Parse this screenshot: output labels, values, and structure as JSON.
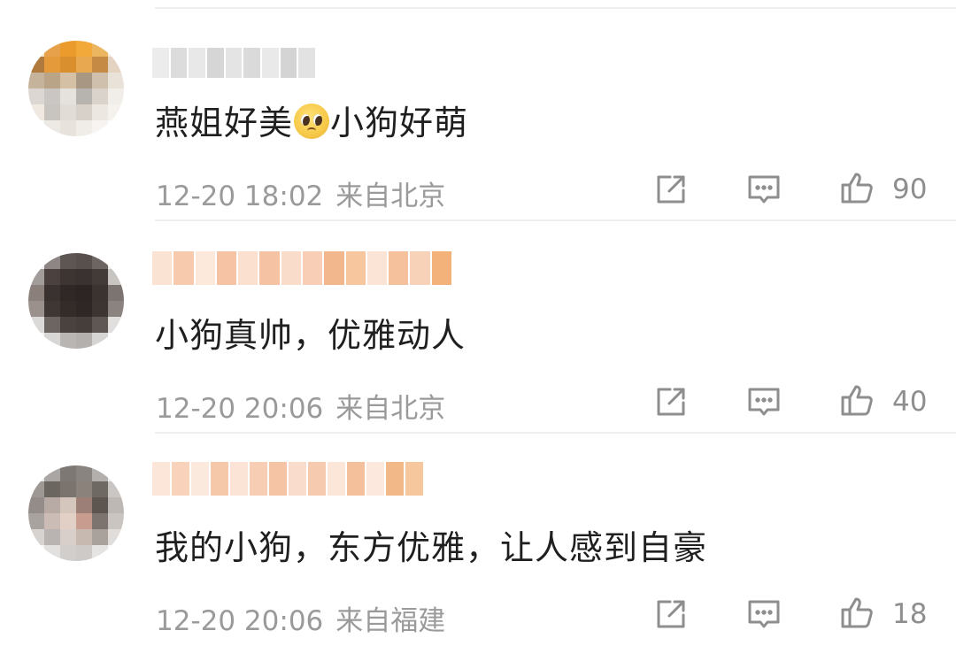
{
  "comments": [
    {
      "text_before": "燕姐好美",
      "emoji": "pleading-face-emoji",
      "text_after": "小狗好萌",
      "time": "12-20 18:02",
      "location": "来自北京",
      "likes": "90",
      "username_blur_colors": [
        "#ececec",
        "#dcdcdc",
        "#e8e8e8",
        "#d6d6d6",
        "#e4e4e4",
        "#dadada",
        "#e9e9e9",
        "#d4d4d4",
        "#e2e2e2"
      ],
      "avatar_colors": [
        "#f4e3c9",
        "#e7a14a",
        "#eb9b2c",
        "#f3a83a",
        "#ecb661",
        "#f6ead6",
        "#b07a3e",
        "#e49a3a",
        "#d98f2d",
        "#e7a84f",
        "#c58a44",
        "#e3d3c0",
        "#c6b39c",
        "#b9a487",
        "#d4c1a5",
        "#a89883",
        "#cfc0ad",
        "#e9e2d9",
        "#dcd7d2",
        "#c9c6c3",
        "#e5e1dc",
        "#b7b3ae",
        "#d9d3cc",
        "#f1ede8",
        "#efe9e2",
        "#c8c4bf",
        "#e2dcd6",
        "#d7d1ca",
        "#ece7e1",
        "#f5f2ee",
        "#fbfaf8",
        "#ede9e4",
        "#e7e2dc",
        "#f0ece7",
        "#f7f4f1",
        "#fdfcfb"
      ]
    },
    {
      "text": "小狗真帅，优雅动人",
      "time": "12-20 20:06",
      "location": "来自北京",
      "likes": "40",
      "username_blur_colors": [
        "#fbe3d3",
        "#f7c9ad",
        "#fde9dc",
        "#f6c4a5",
        "#fbe0cf",
        "#f5c2a3",
        "#fadccb",
        "#f8cfb6",
        "#f3b78d",
        "#f7c69f",
        "#fbe4d6",
        "#f5c09c",
        "#f7d2b8",
        "#f2b27a"
      ],
      "avatar_colors": [
        "#efeeed",
        "#8d8684",
        "#5e5653",
        "#58504d",
        "#6c6562",
        "#e8e7e6",
        "#a29c9a",
        "#4b423f",
        "#3d3532",
        "#3a3230",
        "#433b38",
        "#c7c4c2",
        "#8a7f7b",
        "#3a3230",
        "#2f2826",
        "#2c2523",
        "#3b3330",
        "#7c7471",
        "#9a918d",
        "#3f3734",
        "#332c29",
        "#2e2725",
        "#3d3532",
        "#8b8380",
        "#dcdad9",
        "#6d6562",
        "#4a423f",
        "#463e3b",
        "#5f5754",
        "#e1dfde",
        "#f6f5f5",
        "#d9d7d6",
        "#b9b5b3",
        "#b4b0ae",
        "#d7d5d4",
        "#fbfbfb"
      ]
    },
    {
      "text": "我的小狗，东方优雅，让人感到自豪",
      "time": "12-20 20:06",
      "location": "来自福建",
      "likes": "18",
      "username_blur_colors": [
        "#fbe6d9",
        "#f8d2bb",
        "#fce9dd",
        "#f6c8aa",
        "#fbe4d6",
        "#f7cdb3",
        "#f5c4a5",
        "#f9dccb",
        "#f6caae",
        "#fbe6d8",
        "#f4c09c",
        "#fce8dc",
        "#f3b887",
        "#f6c79c"
      ],
      "avatar_colors": [
        "#e9e8e7",
        "#a9a6a4",
        "#7d7874",
        "#8a8480",
        "#b3afac",
        "#eceae9",
        "#9d9894",
        "#6c6661",
        "#7a736e",
        "#8b827c",
        "#6f6964",
        "#c9c6c3",
        "#938c88",
        "#b8aba5",
        "#d4c5bd",
        "#9c7f76",
        "#5d5550",
        "#bdb8b4",
        "#a9a39f",
        "#cbbdb6",
        "#e2cfc5",
        "#c89d8f",
        "#7e746f",
        "#cac5c1",
        "#d6d3d1",
        "#b9b4b1",
        "#d8cfca",
        "#c7b8b0",
        "#a9a19c",
        "#e0ddda",
        "#f7f6f5",
        "#e3e1df",
        "#d1cecc",
        "#cdcac8",
        "#e6e4e2",
        "#fbfafa"
      ]
    }
  ],
  "icons": {
    "share": "share-square-icon",
    "reply": "comment-bubble-icon",
    "like": "thumbs-up-icon"
  },
  "colors": {
    "text": "#1f1f1f",
    "meta": "#9a9a9a",
    "icon": "#8e8e8e",
    "divider": "#efefef"
  }
}
